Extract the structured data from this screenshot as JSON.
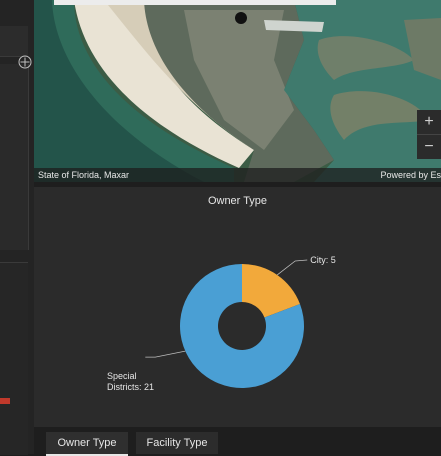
{
  "map": {
    "attribution_left": "State of Florida, Maxar",
    "attribution_right": "Powered by Es",
    "zoom_in_label": "+",
    "zoom_out_label": "−",
    "expand_icon": "expand-icon"
  },
  "chart": {
    "title": "Owner Type"
  },
  "chart_data": {
    "type": "pie",
    "title": "Owner Type",
    "donut": true,
    "categories": [
      "City",
      "Special Districts"
    ],
    "values": [
      5,
      21
    ],
    "labels": [
      "City: 5",
      "Special Districts: 21"
    ],
    "colors": [
      "#f2a93b",
      "#4a9fd4"
    ]
  },
  "tabs": [
    {
      "label": "Owner Type",
      "active": true
    },
    {
      "label": "Facility Type",
      "active": false
    }
  ]
}
